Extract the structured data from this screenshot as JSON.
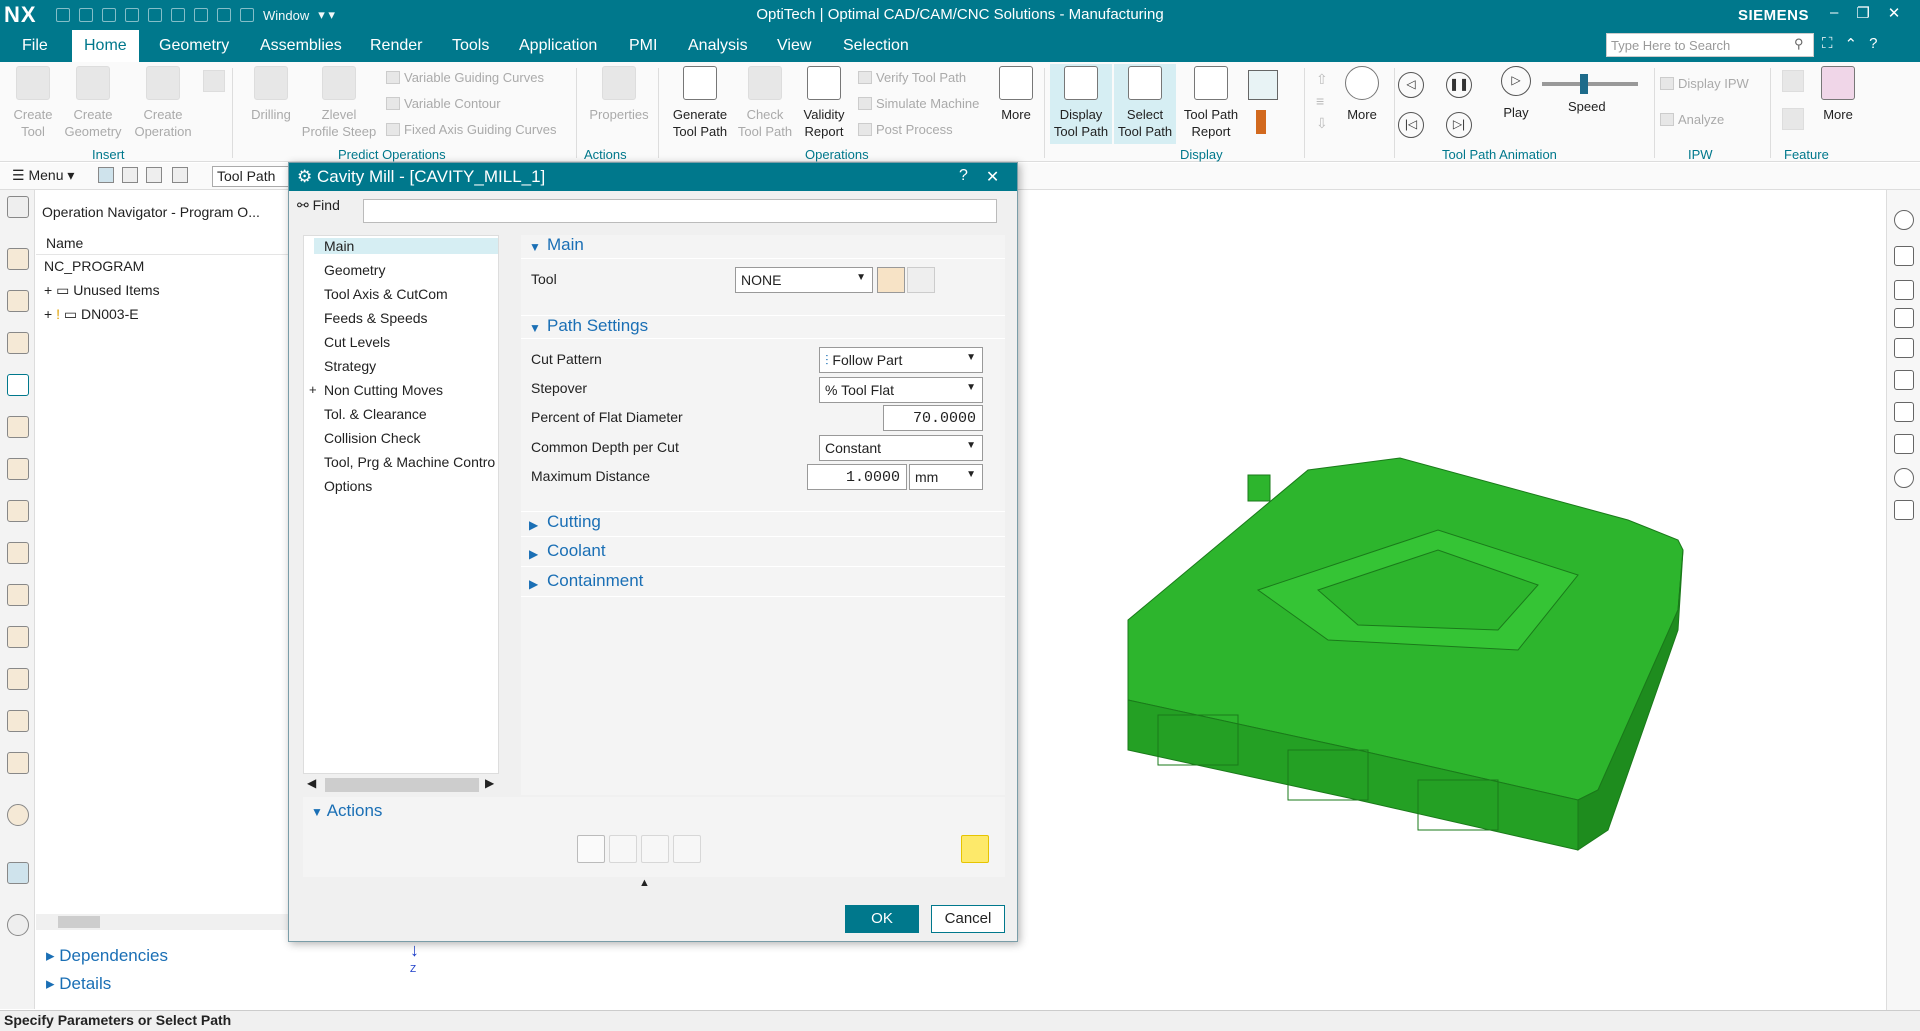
{
  "titlebar": {
    "logo": "NX",
    "window_menu": "Window",
    "title": "OptiTech | Optimal CAD/CAM/CNC Solutions - Manufacturing",
    "brand": "SIEMENS",
    "min": "–",
    "restore": "❐",
    "close": "✕"
  },
  "menubar": {
    "items": [
      "File",
      "Home",
      "Geometry",
      "Assemblies",
      "Render",
      "Tools",
      "Application",
      "PMI",
      "Analysis",
      "View",
      "Selection"
    ],
    "search_placeholder": "Type Here to Search"
  },
  "ribbon": {
    "insert": {
      "create_tool": "Create\nTool",
      "create_geometry": "Create\nGeometry",
      "create_operation": "Create\nOperation",
      "group": "Insert"
    },
    "predict": {
      "drilling": "Drilling",
      "zlevel": "Zlevel\nProfile Steep",
      "vgc": "Variable Guiding Curves",
      "vc": "Variable Contour",
      "fagc": "Fixed Axis Guiding Curves",
      "group": "Predict Operations"
    },
    "actions": {
      "properties": "Properties",
      "group": "Actions"
    },
    "operations": {
      "generate": "Generate\nTool Path",
      "check": "Check\nTool Path",
      "validity": "Validity\nReport",
      "verify": "Verify Tool Path",
      "simulate": "Simulate Machine",
      "post": "Post Process",
      "more": "More",
      "group": "Operations"
    },
    "display": {
      "display_tp": "Display\nTool Path",
      "select_tp": "Select\nTool Path",
      "tp_report": "Tool Path\nReport",
      "group": "Display"
    },
    "more2": "More",
    "animation": {
      "play": "Play",
      "speed": "Speed",
      "group": "Tool Path Animation"
    },
    "ipw": {
      "display_ipw": "Display IPW",
      "analyze": "Analyze",
      "group": "IPW"
    },
    "feature": {
      "more": "More",
      "group": "Feature"
    }
  },
  "toolbar2": {
    "menu": "Menu",
    "filter": "Tool Path"
  },
  "navigator": {
    "title": "Operation Navigator - Program O...",
    "column": "Name",
    "rows": [
      "NC_PROGRAM",
      "Unused Items",
      "DN003-E"
    ],
    "dependencies": "Dependencies",
    "details": "Details"
  },
  "dialog": {
    "title": "Cavity Mill - [CAVITY_MILL_1]",
    "help": "?",
    "close": "✕",
    "find_label": "Find",
    "tree": [
      "Main",
      "Geometry",
      "Tool Axis & CutCom",
      "Feeds & Speeds",
      "Cut Levels",
      "Strategy",
      "Non Cutting Moves",
      "Tol. & Clearance",
      "Collision Check",
      "Tool, Prg & Machine Contro",
      "Options"
    ],
    "main": {
      "section": "Main",
      "tool_label": "Tool",
      "tool_value": "NONE"
    },
    "path_settings": {
      "section": "Path Settings",
      "cut_pattern_label": "Cut Pattern",
      "cut_pattern_value": "Follow Part",
      "stepover_label": "Stepover",
      "stepover_value": "% Tool Flat",
      "percent_label": "Percent of Flat Diameter",
      "percent_value": "70.0000",
      "depth_label": "Common Depth per Cut",
      "depth_value": "Constant",
      "maxdist_label": "Maximum Distance",
      "maxdist_value": "1.0000",
      "unit": "mm"
    },
    "collapsed": [
      "Cutting",
      "Coolant",
      "Containment"
    ],
    "actions": "Actions",
    "ok": "OK",
    "cancel": "Cancel"
  },
  "graphics": {
    "axis_label": "Z",
    "part_color": "#2db52d"
  },
  "status": "Specify Parameters or Select Path"
}
